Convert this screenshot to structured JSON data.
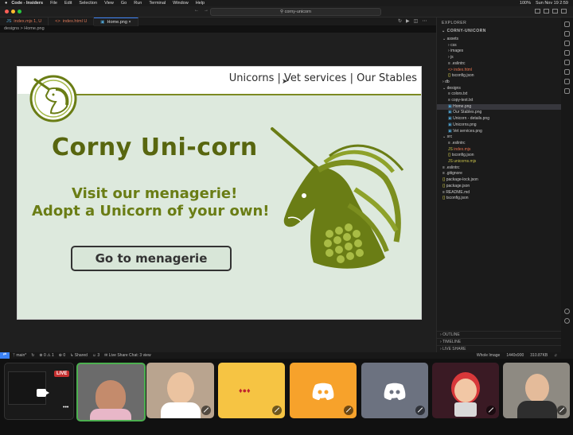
{
  "macos_menu": {
    "apple": "",
    "items": [
      "Code - Insiders",
      "File",
      "Edit",
      "Selection",
      "View",
      "Go",
      "Run",
      "Terminal",
      "Window",
      "Help"
    ],
    "battery": "100%",
    "datetime": "Sun Nov 19 2:59"
  },
  "window": {
    "title": "corny-unicorn",
    "back": "←",
    "forward": "→"
  },
  "tabs": [
    {
      "label": "index.mjs 1, U",
      "icon": "js-icon"
    },
    {
      "label": "index.html U",
      "icon": "html-icon"
    },
    {
      "label": "Home.png",
      "icon": "image-icon"
    }
  ],
  "breadcrumb": {
    "folder": "designs",
    "sep": ">",
    "file": "Home.png"
  },
  "mockup": {
    "nav_text": "Unicorns | Vet services | Our Stables",
    "brand": "Corny Uni-corn",
    "tagline1": "Visit our menagerie!",
    "tagline2": "Adopt a  Unicorn of your own!",
    "cta": "Go to menagerie",
    "accent_color": "#6a7d15"
  },
  "explorer": {
    "header": "EXPLORER",
    "project": "CORNY-UNICORN",
    "tree": [
      {
        "label": "assets",
        "indent": 1,
        "kind": "folder-open"
      },
      {
        "label": "css",
        "indent": 2,
        "kind": "folder"
      },
      {
        "label": "images",
        "indent": 2,
        "kind": "folder"
      },
      {
        "label": "js",
        "indent": 2,
        "kind": "folder"
      },
      {
        "label": ".eslintrc",
        "indent": 2,
        "kind": "file"
      },
      {
        "label": "index.html",
        "indent": 2,
        "kind": "html"
      },
      {
        "label": "tsconfig.json",
        "indent": 2,
        "kind": "json"
      },
      {
        "label": "db",
        "indent": 1,
        "kind": "folder"
      },
      {
        "label": "designs",
        "indent": 1,
        "kind": "folder-open"
      },
      {
        "label": "colors.txt",
        "indent": 2,
        "kind": "file"
      },
      {
        "label": "copy-text.txt",
        "indent": 2,
        "kind": "file"
      },
      {
        "label": "Home.png",
        "indent": 2,
        "kind": "image",
        "selected": true
      },
      {
        "label": "Our Stables.png",
        "indent": 2,
        "kind": "image"
      },
      {
        "label": "Unicorn - details.png",
        "indent": 2,
        "kind": "image"
      },
      {
        "label": "Unicorns.png",
        "indent": 2,
        "kind": "image"
      },
      {
        "label": "Vet services.png",
        "indent": 2,
        "kind": "image"
      },
      {
        "label": "src",
        "indent": 1,
        "kind": "folder-open"
      },
      {
        "label": ".eslintrc",
        "indent": 2,
        "kind": "file"
      },
      {
        "label": "index.mjs",
        "indent": 2,
        "kind": "js"
      },
      {
        "label": "tsconfig.json",
        "indent": 2,
        "kind": "json"
      },
      {
        "label": "unicorns.mjs",
        "indent": 2,
        "kind": "js"
      },
      {
        "label": ".eslintrc",
        "indent": 1,
        "kind": "file"
      },
      {
        "label": ".gitignore",
        "indent": 1,
        "kind": "file"
      },
      {
        "label": "package-lock.json",
        "indent": 1,
        "kind": "json"
      },
      {
        "label": "package.json",
        "indent": 1,
        "kind": "json"
      },
      {
        "label": "README.md",
        "indent": 1,
        "kind": "file"
      },
      {
        "label": "tsconfig.json",
        "indent": 1,
        "kind": "json"
      }
    ],
    "footer": [
      "OUTLINE",
      "TIMELINE",
      "LIVE SHARE"
    ]
  },
  "statusbar": {
    "branch": "main*",
    "problems": "⊗ 0 ⚠ 1",
    "ports": "0",
    "shared": "Shared",
    "share_count": "3",
    "live_share": "Live Share Chat: 3 view",
    "image_label": "Whole Image",
    "dimensions": "1440x900",
    "filesize": "310.87KB"
  },
  "call": {
    "live_badge": "LIVE",
    "more": "•••"
  }
}
